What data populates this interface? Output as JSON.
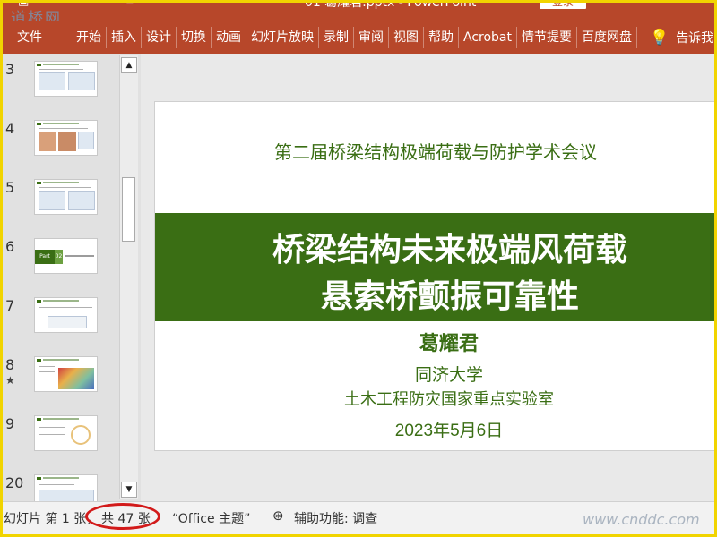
{
  "app": {
    "filename": "01 葛耀君.pptx",
    "app_name": "PowerPoint",
    "login_label": "登录",
    "watermark_top": "道桥网",
    "watermark_bottom": "www.cnddc.com"
  },
  "ribbon": {
    "tabs": [
      "文件",
      "开始",
      "插入",
      "设计",
      "切换",
      "动画",
      "幻灯片放映",
      "录制",
      "审阅",
      "视图",
      "帮助",
      "Acrobat",
      "情节提要",
      "百度网盘"
    ],
    "tell_me": "告诉我"
  },
  "thumbnails": [
    {
      "num": "3",
      "star": ""
    },
    {
      "num": "4",
      "star": ""
    },
    {
      "num": "5",
      "star": ""
    },
    {
      "num": "6",
      "star": "",
      "part_label": "Part",
      "part_num": "02"
    },
    {
      "num": "7",
      "star": ""
    },
    {
      "num": "8",
      "star": "★"
    },
    {
      "num": "9",
      "star": ""
    },
    {
      "num": "20",
      "star": ""
    }
  ],
  "slide": {
    "conference": "第二届桥梁结构极端荷载与防护学术会议",
    "title_line1": "桥梁结构未来极端风荷载",
    "title_line2": "悬索桥颤振可靠性",
    "author": "葛耀君",
    "institution": "同济大学",
    "laboratory": "土木工程防灾国家重点实验室",
    "date": "2023年5月6日"
  },
  "status": {
    "slide_info": "幻灯片 第 1 张，",
    "total": "共 47 张",
    "theme": "“Office 主题”",
    "accessibility": "辅助功能: 调查"
  },
  "colors": {
    "ribbon": "#b7472a",
    "slide_green": "#3a6e14",
    "annotation_red": "#d21a1a"
  }
}
